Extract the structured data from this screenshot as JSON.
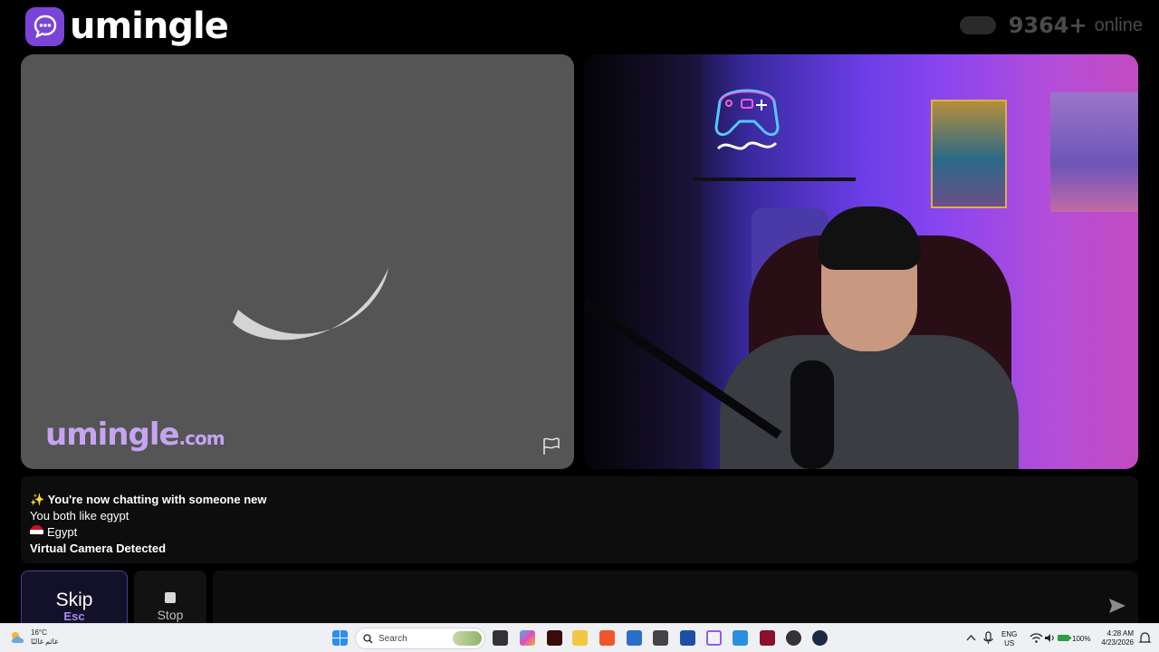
{
  "header": {
    "brand": "umingle",
    "online_count": "9364+",
    "online_label": "online"
  },
  "video_left": {
    "watermark_main": "umingle",
    "watermark_suffix": ".com"
  },
  "chat": {
    "messages": [
      {
        "text": "✨ You're now chatting with someone new",
        "bold": true
      },
      {
        "text": "You both like egypt",
        "bold": false
      },
      {
        "text": "Egypt",
        "bold": false,
        "flag": "egypt-flag"
      },
      {
        "text": "Virtual Camera Detected",
        "bold": true
      }
    ]
  },
  "controls": {
    "skip_label": "Skip",
    "skip_key": "Esc",
    "stop_label": "Stop",
    "message_placeholder": ""
  },
  "colors": {
    "brand_purple": "#7b44d9",
    "skip_key_color": "#a88bf0",
    "watermark_color": "#c6a4f2",
    "left_video_bg": "#555555"
  },
  "taskbar": {
    "weather_temp": "16°C",
    "weather_desc": "غائم غالبًا",
    "search_placeholder": "Search",
    "lang_top": "ENG",
    "lang_bottom": "US",
    "battery": "100%",
    "time": "4:28 AM",
    "date": "4/23/2026"
  },
  "icons": {
    "brand": "chat-bubble-icon",
    "report": "flag-icon",
    "send": "send-icon",
    "stop": "stop-square-icon",
    "spinner": "loading-arc-icon"
  }
}
